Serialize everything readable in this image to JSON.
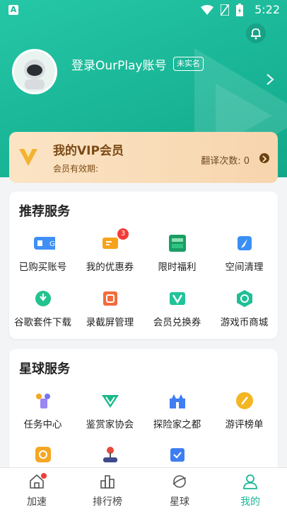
{
  "status_bar": {
    "app_indicator": "A",
    "time": "5:22"
  },
  "profile": {
    "login_text": "登录OurPlay账号",
    "verify_badge": "未实名"
  },
  "vip": {
    "title": "我的VIP会员",
    "subtitle": "会员有效期:",
    "translate_label": "翻译次数: 0"
  },
  "recommended": {
    "title": "推荐服务",
    "items": [
      {
        "label": "已购买账号",
        "icon": "purchased-account-icon"
      },
      {
        "label": "我的优惠券",
        "icon": "coupon-icon",
        "badge": "3"
      },
      {
        "label": "限时福利",
        "icon": "limited-welfare-icon"
      },
      {
        "label": "空间清理",
        "icon": "space-cleanup-icon"
      },
      {
        "label": "谷歌套件下载",
        "icon": "google-suite-download-icon"
      },
      {
        "label": "录截屏管理",
        "icon": "screen-record-icon"
      },
      {
        "label": "会员兑换券",
        "icon": "vip-voucher-icon"
      },
      {
        "label": "游戏币商城",
        "icon": "game-coin-mall-icon"
      }
    ]
  },
  "planet": {
    "title": "星球服务",
    "items": [
      {
        "label": "任务中心",
        "icon": "task-center-icon"
      },
      {
        "label": "鉴赏家协会",
        "icon": "connoisseur-association-icon"
      },
      {
        "label": "探险家之都",
        "icon": "explorer-capital-icon"
      },
      {
        "label": "游评榜单",
        "icon": "review-ranking-icon"
      }
    ]
  },
  "tabbar": [
    {
      "label": "加速",
      "icon": "home-icon",
      "active": false
    },
    {
      "label": "排行榜",
      "icon": "ranking-icon",
      "active": false
    },
    {
      "label": "星球",
      "icon": "planet-icon",
      "active": false
    },
    {
      "label": "我的",
      "icon": "profile-icon",
      "active": true
    }
  ],
  "colors": {
    "brand": "#1bb797",
    "vip_text": "#7b4a17",
    "badge": "#f43c37"
  }
}
